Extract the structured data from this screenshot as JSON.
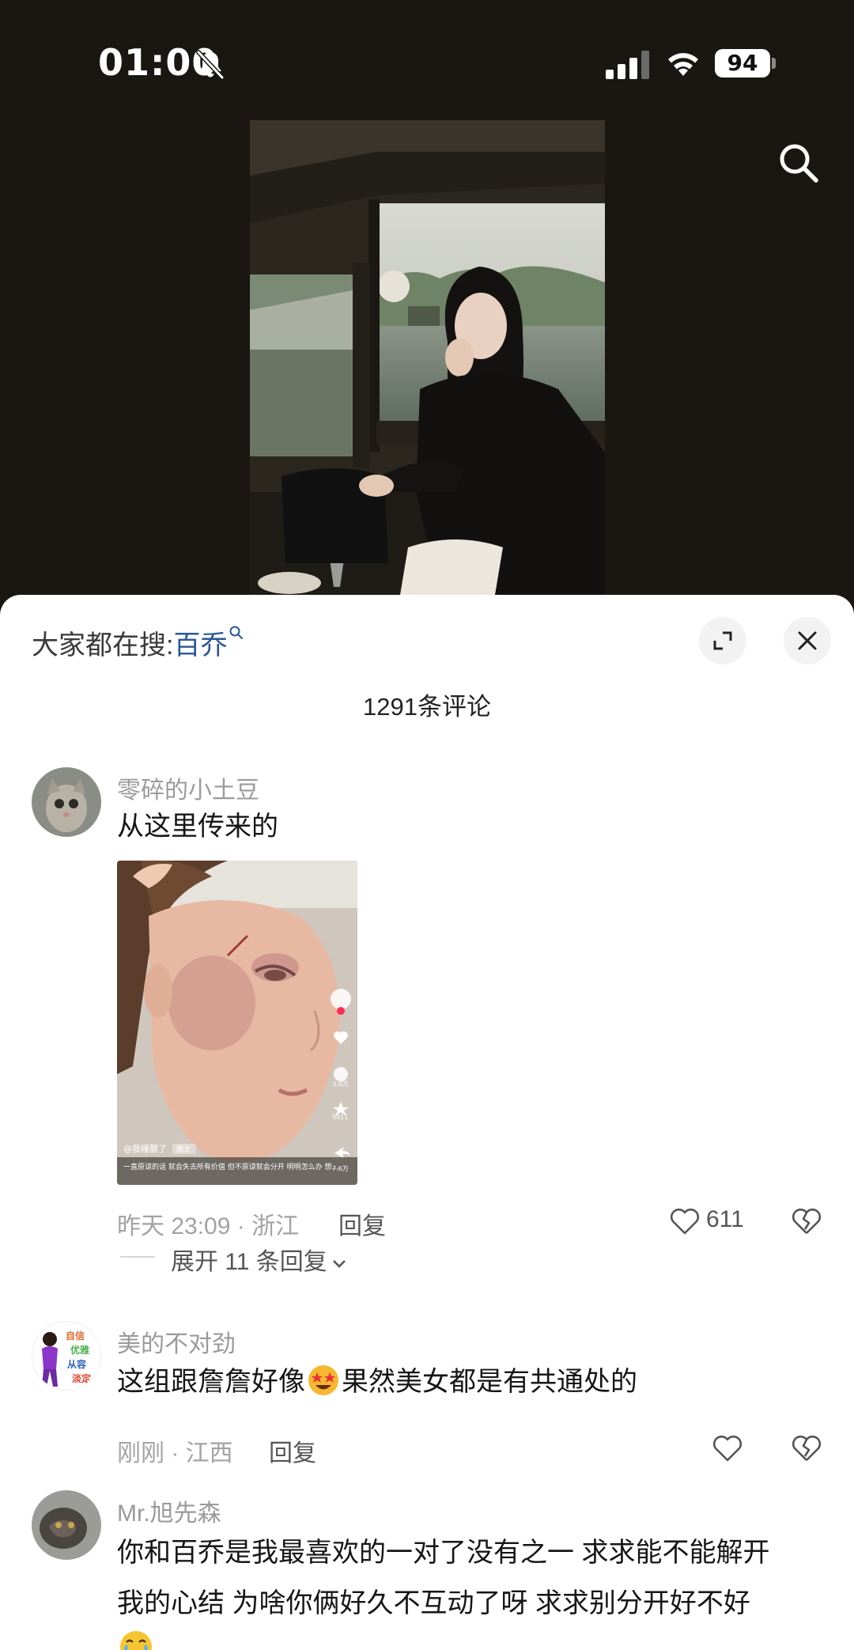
{
  "status_bar": {
    "time": "01:00",
    "battery": "94"
  },
  "sheet": {
    "trending_prefix": "大家都在搜:",
    "trending_term": "百乔",
    "comment_count": "1291条评论",
    "reply_label": "回复",
    "comments": [
      {
        "username": "零碎的小土豆",
        "text": "从这里传来的",
        "meta": "昨天 23:09 · 浙江",
        "likes": "611",
        "expand_replies": "展开 11 条回复"
      },
      {
        "username": "美的不对劲",
        "text_before": "这组跟詹詹好像",
        "text_after": "果然美女都是有共通处的",
        "meta": "刚刚 · 江西",
        "likes": ""
      },
      {
        "username": "Mr.旭先森",
        "line1": "你和百乔是我最喜欢的一对了没有之一 求求能不能解开",
        "line2": "我的心结 为啥你俩好久不互动了呀 求求别分开好不好"
      }
    ]
  },
  "avatar2_text": {
    "l1": "自信",
    "l2": "优雅",
    "l3": "从容",
    "l4": "淡定"
  },
  "thumbnail_overlay": {
    "handle": "@我睡醒了",
    "tag": "图文",
    "caption": "一直原谅的话 就会失去所有价值 但不原谅就会分开 明明怎么办 想...",
    "stats": [
      "3.0万",
      "5911",
      "7.6万"
    ]
  },
  "icons": {
    "mute": "bell-slash-icon",
    "search": "search-icon",
    "expand": "expand-icon",
    "close": "close-icon",
    "like": "heart-icon",
    "dislike": "broken-heart-icon"
  }
}
